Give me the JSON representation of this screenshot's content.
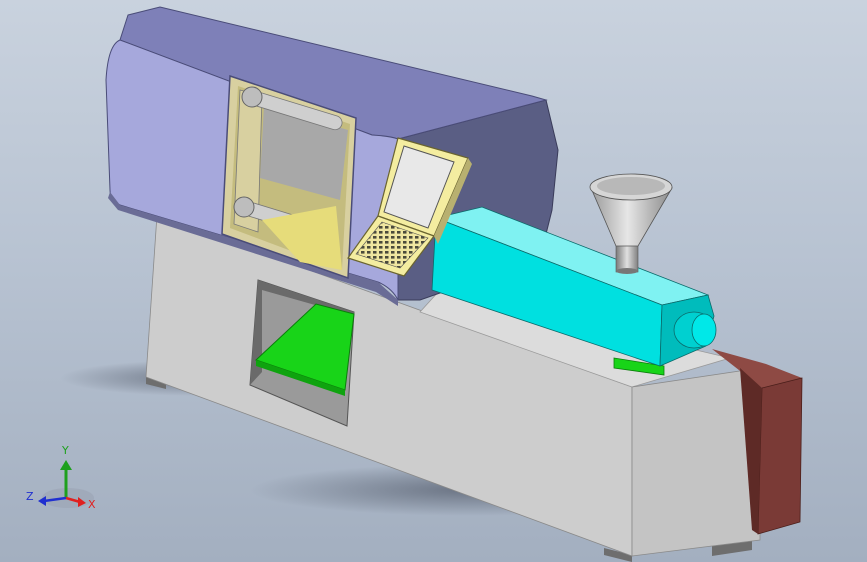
{
  "triad": {
    "x_label": "X",
    "y_label": "Y",
    "z_label": "Z",
    "x_color": "#e02020",
    "y_color": "#1ea01e",
    "z_color": "#2030d0"
  },
  "model": {
    "icon": "injection-molding-machine-model",
    "colors": {
      "housing": "#a6a8dc",
      "base": "#cfcfcf",
      "barrel": "#00e0e0",
      "control_panel": "#f4eda0",
      "tray": "#18d418",
      "motor_block": "#7a3a36",
      "hopper": "#c8c8c8"
    }
  }
}
